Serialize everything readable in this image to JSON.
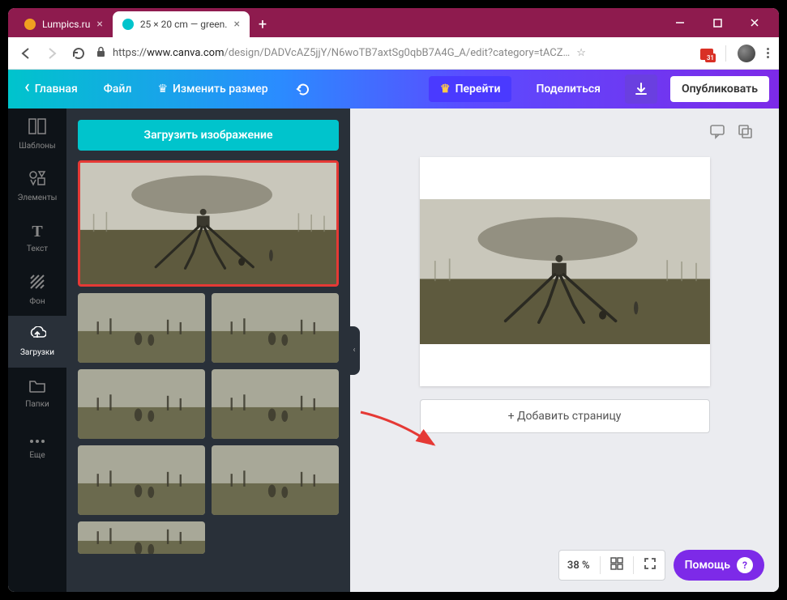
{
  "browser": {
    "tabs": [
      {
        "title": "Lumpics.ru",
        "favicon": "#f0a020",
        "active": false
      },
      {
        "title": "25 × 20 cm — green.",
        "favicon": "#00c4cc",
        "active": true
      }
    ],
    "url_prefix": "https://",
    "url_domain": "www.canva.com",
    "url_path": "/design/DADVcAZ5jjY/N6woTB7axtSg0qbB7A4G_A/edit?category=tACZ…",
    "ext_badge": "31"
  },
  "header": {
    "home": "Главная",
    "file": "Файл",
    "resize": "Изменить размер",
    "go": "Перейти",
    "share": "Поделиться",
    "publish": "Опубликовать"
  },
  "sidebar": {
    "items": [
      {
        "label": "Шаблоны",
        "icon": "templates"
      },
      {
        "label": "Элементы",
        "icon": "elements"
      },
      {
        "label": "Текст",
        "icon": "text"
      },
      {
        "label": "Фон",
        "icon": "background"
      },
      {
        "label": "Загрузки",
        "icon": "uploads",
        "active": true
      },
      {
        "label": "Папки",
        "icon": "folders"
      },
      {
        "label": "Еще",
        "icon": "more"
      }
    ]
  },
  "panel": {
    "upload": "Загрузить изображение"
  },
  "canvas": {
    "add_page": "+ Добавить страницу",
    "zoom": "38 %"
  },
  "help": "Помощь"
}
